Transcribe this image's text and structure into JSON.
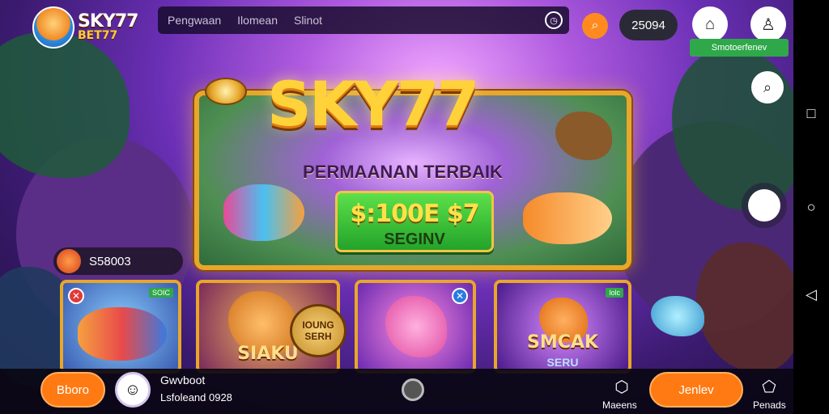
{
  "brand": {
    "name": "SKY77",
    "sub": "BET77"
  },
  "nav": {
    "items": [
      "Pengwaan",
      "Ilomean",
      "Slinot"
    ]
  },
  "header": {
    "credit": "25094",
    "green_banner": "Smotoerfenev"
  },
  "hero": {
    "title": "SKY77",
    "subtitle": "PERMAANAN TERBAIK",
    "cta_main": "$:100E $7",
    "cta_sub": "SEGINV"
  },
  "balance": "S58003",
  "cards": [
    {
      "badge": "SOIC",
      "title": ""
    },
    {
      "badge": "",
      "title": "SIAKU",
      "seal_line1": "IOUNG",
      "seal_line2": "SERH"
    },
    {
      "badge": "",
      "title": ""
    },
    {
      "badge": "lolc",
      "title": "SMCAK",
      "sub": "SERU"
    }
  ],
  "bottom": {
    "left_button": "Bboro",
    "user_name": "Gwvboot",
    "user_time": "Lsfoleand 0928",
    "maps_label": "Maeens",
    "right_button": "Jenlev",
    "rewards_label": "Penads"
  },
  "colors": {
    "accent": "#ff7a12",
    "gold": "#e8a72a",
    "green": "#2fa84a"
  }
}
